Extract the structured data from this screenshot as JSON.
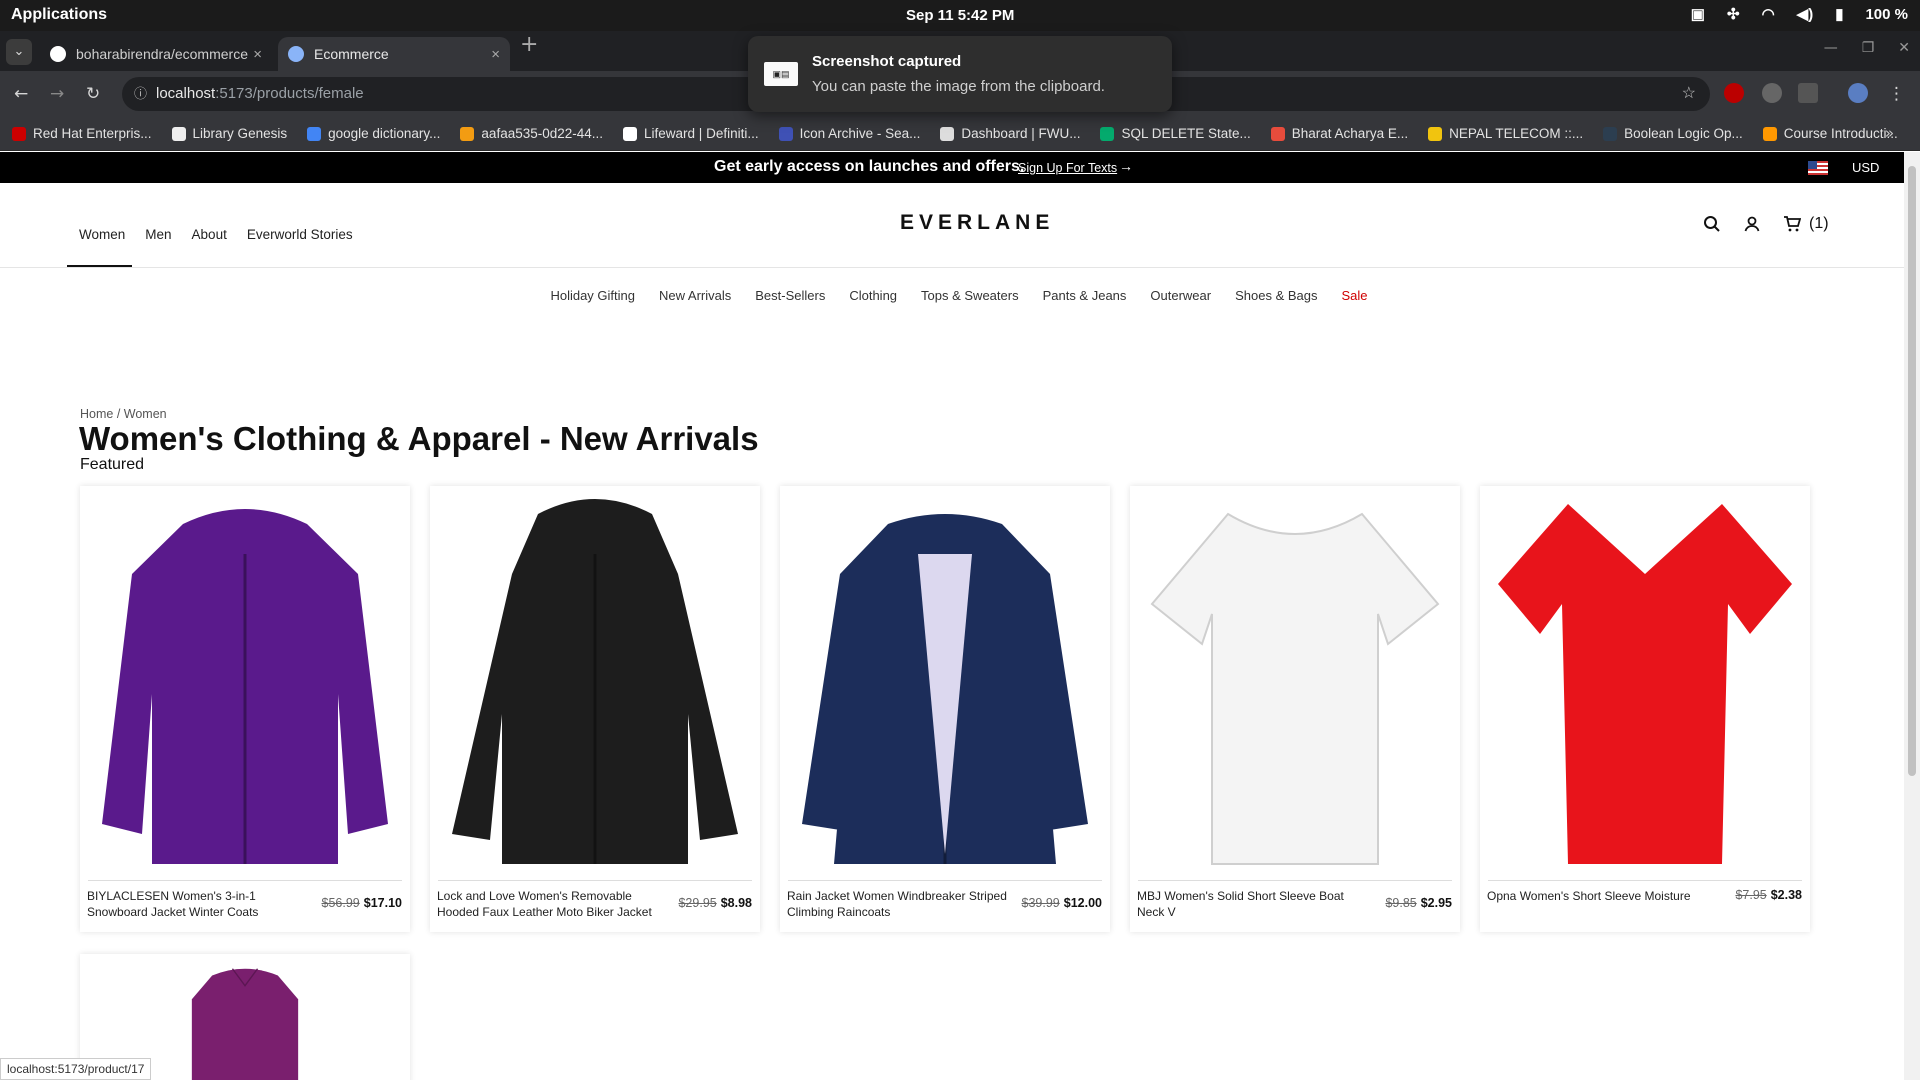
{
  "os": {
    "applications": "Applications",
    "clock": "Sep 11  5:42 PM",
    "battery": "100 %"
  },
  "browser": {
    "tabs": [
      {
        "title": "boharabirendra/ecommerce",
        "active": false
      },
      {
        "title": "Ecommerce",
        "active": true
      }
    ],
    "url_host": "localhost",
    "url_path": ":5173/products/female",
    "bookmarks": [
      {
        "label": "Red Hat Enterpris...",
        "color": "#cc0000"
      },
      {
        "label": "Library Genesis",
        "color": "#eeeeee"
      },
      {
        "label": "google dictionary...",
        "color": "#4285f4"
      },
      {
        "label": "aafaa535-0d22-44...",
        "color": "#f39c12"
      },
      {
        "label": "Lifeward | Definiti...",
        "color": "#ffffff"
      },
      {
        "label": "Icon Archive - Sea...",
        "color": "#3f51b5"
      },
      {
        "label": "Dashboard | FWU...",
        "color": "#dddddd"
      },
      {
        "label": "SQL DELETE State...",
        "color": "#04aa6d"
      },
      {
        "label": "Bharat Acharya E...",
        "color": "#e74c3c"
      },
      {
        "label": "NEPAL TELECOM ::...",
        "color": "#f1c40f"
      },
      {
        "label": "Boolean Logic Op...",
        "color": "#2c3e50"
      },
      {
        "label": "Course Introducti...",
        "color": "#ff9800"
      }
    ]
  },
  "toast": {
    "title": "Screenshot captured",
    "body": "You can paste the image from the clipboard."
  },
  "promo": {
    "text": "Get early access on launches and offers.",
    "link": "Sign Up For Texts",
    "arrow": "→",
    "currency": "USD"
  },
  "header": {
    "nav": [
      "Women",
      "Men",
      "About",
      "Everworld Stories"
    ],
    "logo": "EVERLANE",
    "cart_count": "(1)"
  },
  "subnav": [
    "Holiday Gifting",
    "New Arrivals",
    "Best-Sellers",
    "Clothing",
    "Tops & Sweaters",
    "Pants & Jeans",
    "Outerwear",
    "Shoes & Bags",
    "Sale"
  ],
  "breadcrumb": "Home / Women",
  "title": "Women's Clothing & Apparel - New Arrivals",
  "subtitle": "Featured",
  "products": [
    {
      "name": "BIYLACLESEN Women's 3-in-1 Snowboard Jacket Winter Coats",
      "old": "$56.99",
      "price": "$17.10",
      "color": "#5a1a8c"
    },
    {
      "name": "Lock and Love Women's Removable Hooded Faux Leather Moto Biker Jacket",
      "old": "$29.95",
      "price": "$8.98",
      "color": "#1d1d1d"
    },
    {
      "name": "Rain Jacket Women Windbreaker Striped Climbing Raincoats",
      "old": "$39.99",
      "price": "$12.00",
      "color": "#1c2d5a"
    },
    {
      "name": "MBJ Women's Solid Short Sleeve Boat Neck V",
      "old": "$9.85",
      "price": "$2.95",
      "color": "#f4f4f4"
    },
    {
      "name": "Opna Women's Short Sleeve Moisture",
      "old": "$7.95",
      "price": "$2.38",
      "color": "#e8141b"
    }
  ],
  "status_url": "localhost:5173/product/17"
}
